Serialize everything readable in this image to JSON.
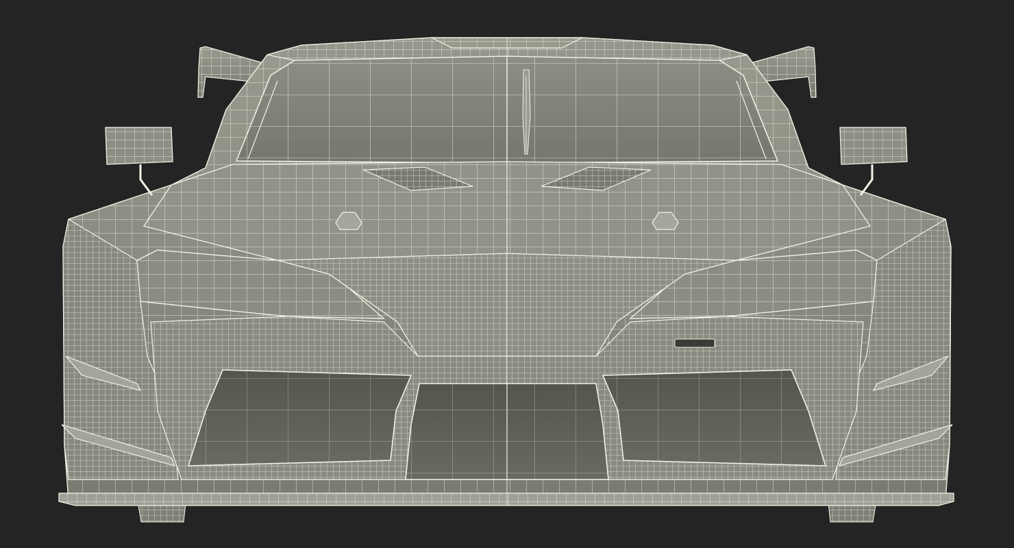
{
  "scene": {
    "subject": "race-car-wireframe-front-view",
    "colors": {
      "background": "#242424",
      "body": "#8a8a80",
      "body_dark": "#6b6b62",
      "body_light": "#a3a398",
      "wire": "#f2f2e6",
      "intake": "#5a5a52",
      "intake_deep": "#4a4a44",
      "badge": "#3a3a36"
    }
  }
}
